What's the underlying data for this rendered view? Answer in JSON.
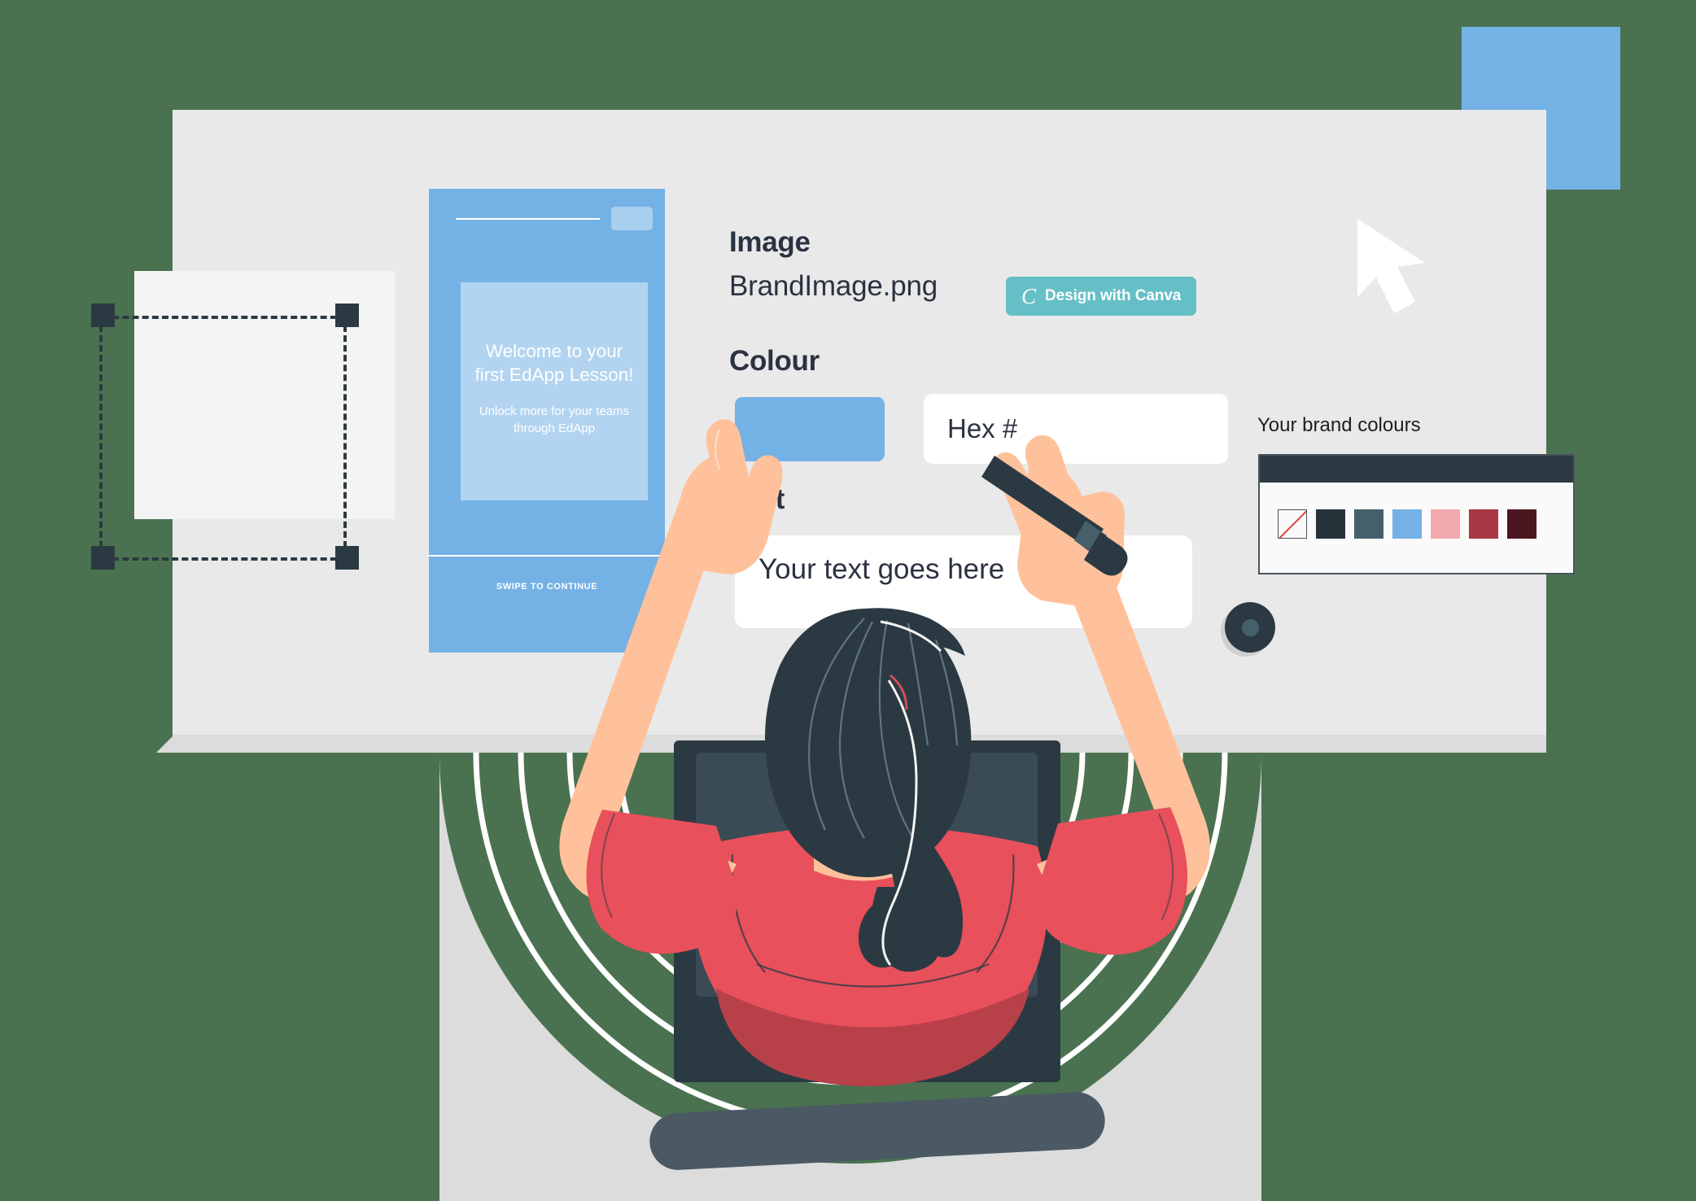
{
  "canvas": {
    "background_color": "#4a7250",
    "panel_color": "#e9e9e9",
    "accent_blue": "#74b2e5",
    "text_color": "#2b3240"
  },
  "decor": {
    "blue_square_name": "decorative-blue-square",
    "cursor_name": "mouse-cursor-arrow"
  },
  "artboard": {
    "name": "selected-artboard",
    "handles": 4
  },
  "phone_preview": {
    "title": "Welcome to your first EdApp Lesson!",
    "subtitle": "Unlock more for your teams through EdApp",
    "footer": "SWIPE TO CONTINUE",
    "bg_color": "#74b2e5",
    "card_color": "#b2d4f0"
  },
  "form": {
    "image_label": "Image",
    "image_filename": "BrandImage.png",
    "canva_button": {
      "logo": "C",
      "label": "Design with Canva",
      "color": "#65bfc6"
    },
    "colour_label": "Colour",
    "colour_value": "#74b2e5",
    "hex_placeholder": "Hex #",
    "text_label": "Text",
    "text_value": "Your text goes here"
  },
  "brand_colours": {
    "title": "Your brand colours",
    "swatches": [
      {
        "name": "none",
        "color": "none"
      },
      {
        "name": "dark-navy",
        "color": "#25323a"
      },
      {
        "name": "slate-grey",
        "color": "#46606b"
      },
      {
        "name": "light-blue",
        "color": "#74b2e5"
      },
      {
        "name": "pink",
        "color": "#f2a9b0"
      },
      {
        "name": "crimson",
        "color": "#a93745"
      },
      {
        "name": "dark-maroon",
        "color": "#4b1620"
      }
    ]
  },
  "illustration": {
    "person": "top-down-person-at-desk",
    "shirt_color": "#e8505b",
    "hair_color": "#2b3a42",
    "skin_color": "#ffc19b",
    "stylus": "stylus-pen",
    "knob": "dial-knob"
  }
}
